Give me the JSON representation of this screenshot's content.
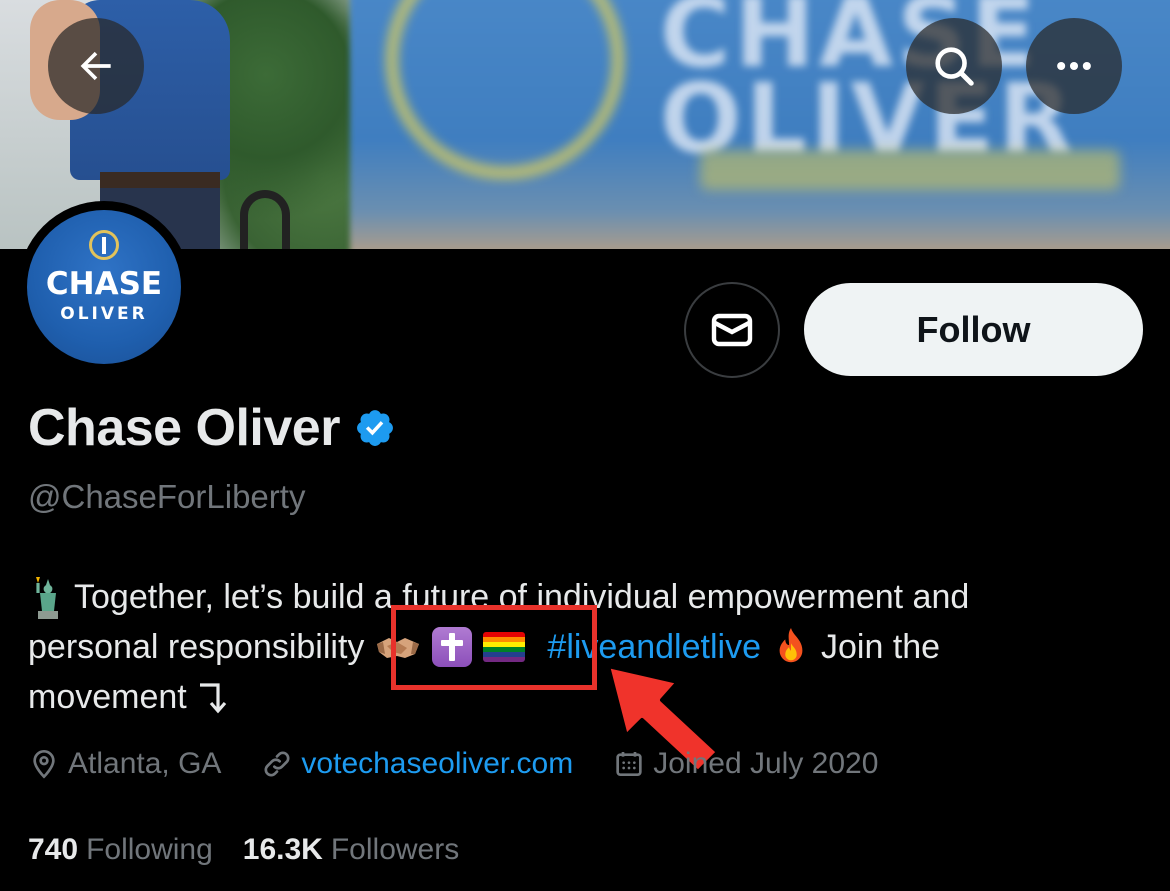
{
  "header": {
    "back_icon": "arrow-left-icon",
    "search_icon": "search-icon",
    "more_icon": "more-horizontal-icon"
  },
  "banner": {
    "sign_text": "CHASE OLIVER"
  },
  "avatar": {
    "line1": "CHASE",
    "line2": "OLIVER"
  },
  "actions": {
    "message_icon": "envelope-icon",
    "follow_label": "Follow"
  },
  "profile": {
    "display_name": "Chase Oliver",
    "verified_icon": "verified-badge-icon",
    "handle": "@ChaseForLiberty"
  },
  "bio": {
    "line1_text": "Together, let’s build a future of individual empowerment and",
    "line2_text": "personal responsibility",
    "hashtag": "#liveandletlive",
    "join_text": "Join the",
    "line3_text": "movement",
    "emojis": [
      "statue-of-liberty-icon",
      "handshake-icon",
      "latin-cross-icon",
      "rainbow-flag-icon",
      "fire-icon",
      "corner-arrow-icon"
    ]
  },
  "meta": {
    "location": "Atlanta, GA",
    "website": "votechaseoliver.com",
    "joined": "Joined July 2020"
  },
  "counts": {
    "following_count": "740",
    "following_label": "Following",
    "followers_count": "16.3K",
    "followers_label": "Followers"
  },
  "colors": {
    "background": "#000000",
    "text_primary": "#e7e9ea",
    "text_secondary": "#71767b",
    "link": "#1d9bf0",
    "follow_bg": "#eff3f4",
    "annotation": "#e8322b"
  }
}
